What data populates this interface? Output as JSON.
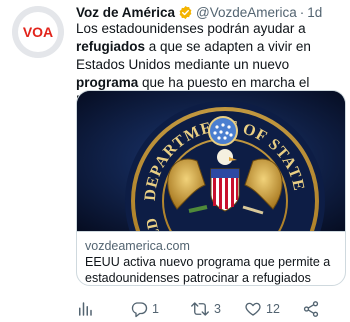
{
  "author": {
    "name": "Voz de América",
    "handle": "@VozdeAmerica",
    "separator": "·",
    "time": "1d",
    "avatar_text": "VOA"
  },
  "tweet": {
    "text_parts": [
      {
        "text": "Los estadounidenses podrán ayudar a ",
        "bold": false
      },
      {
        "text": "refugiados",
        "bold": true
      },
      {
        "text": " a que se adapten a vivir en Estados Unidos mediante un nuevo ",
        "bold": false
      },
      {
        "text": "programa",
        "bold": true
      },
      {
        "text": " que ha puesto en marcha el Departamento de Estado.",
        "bold": false
      }
    ]
  },
  "card": {
    "domain": "vozdeamerica.com",
    "title_line1": "EEUU activa nuevo programa que permite a",
    "title_line2": "estadounidenses patrocinar a refugiados",
    "image_text_top": "DEPARTMENT OF STATE",
    "image_text_left": "UNITED"
  },
  "actions": {
    "reply_count": "1",
    "retweet_count": "3",
    "like_count": "12"
  },
  "colors": {
    "verified": "#f4b400",
    "secondary": "#536471",
    "border": "#cfd9de"
  }
}
